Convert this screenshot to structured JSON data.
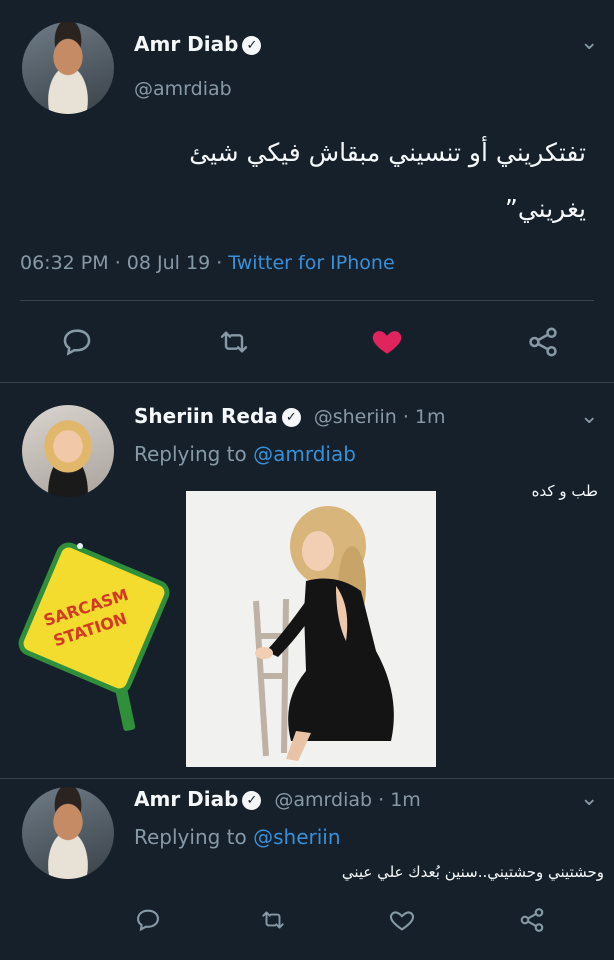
{
  "tweet1": {
    "name": "Amr Diab",
    "handle": "@amrdiab",
    "text_line1": "تفتكريني أو تنسيني مبقاش فيكي شيئ",
    "text_line2": "يغريني”",
    "time": "06:32 PM",
    "date": "08 Jul 19",
    "via": "Twitter for IPhone",
    "liked": true
  },
  "tweet2": {
    "name": "Sheriin Reda",
    "handle": "@sheriin",
    "age": "1m",
    "replying_prefix": "Replying to",
    "replying_to": "@amrdiab",
    "text": "طب و كده",
    "sign_text_1": "SARCASM",
    "sign_text_2": "STATION"
  },
  "tweet3": {
    "name": "Amr Diab",
    "handle": "@amrdiab",
    "age": "1m",
    "replying_prefix": "Replying to",
    "replying_to": "@sheriin",
    "text": "وحشتيني وحشتيني..سنين بُعدك علي عيني"
  },
  "icons": {
    "reply": "comment-icon",
    "retweet": "retweet-icon",
    "like": "heart-icon",
    "share": "share-icon",
    "more": "chevron-down-icon",
    "verified": "verified-badge-icon"
  },
  "colors": {
    "background": "#15202b",
    "link": "#3a90d8",
    "like": "#e0245e",
    "muted": "#8899a6"
  }
}
